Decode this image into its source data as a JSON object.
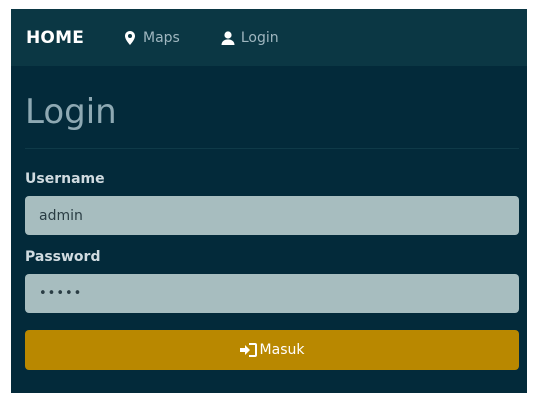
{
  "navbar": {
    "brand": "HOME",
    "links": [
      {
        "label": "Maps",
        "icon": "map-marker-icon"
      },
      {
        "label": "Login",
        "icon": "user-icon"
      }
    ]
  },
  "page": {
    "title": "Login"
  },
  "form": {
    "username_label": "Username",
    "username_value": "admin",
    "password_label": "Password",
    "password_value": "admin",
    "submit_label": "Masuk",
    "submit_icon": "login-icon"
  },
  "colors": {
    "background": "#032a3a",
    "navbar": "#0b3744",
    "input_background": "#a7bdbf",
    "button": "#b98800"
  }
}
